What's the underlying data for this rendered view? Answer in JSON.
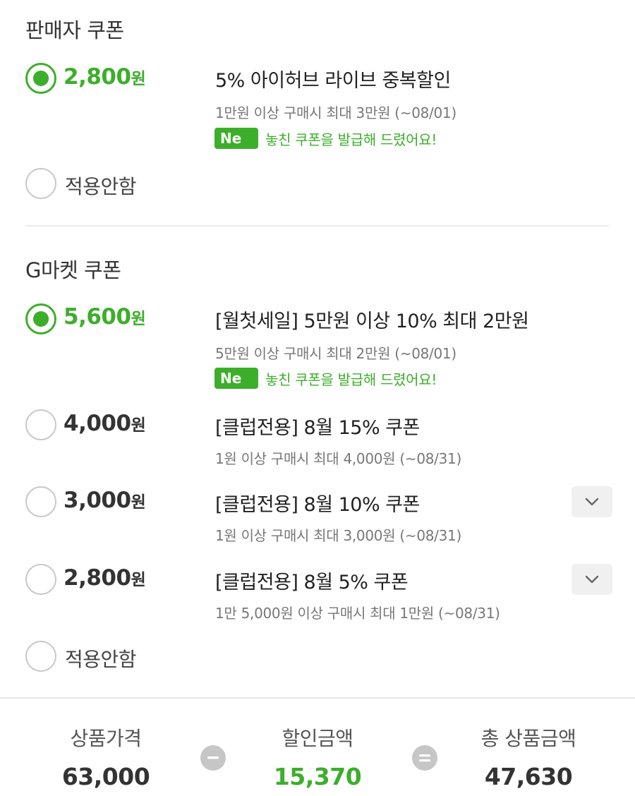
{
  "seller_section": {
    "title": "판매자 쿠폰",
    "options": [
      {
        "amount": "2,800",
        "unit": "원",
        "selected": true,
        "title": "5% 아이허브 라이브 중복할인",
        "condition": "1만원 이상 구매시 최대 3만원 (~08/01)",
        "badge": "Ne",
        "badge_text": "놓친 쿠폰을 발급해 드렸어요!"
      }
    ],
    "none_label": "적용안함"
  },
  "gmarket_section": {
    "title": "G마켓 쿠폰",
    "options": [
      {
        "amount": "5,600",
        "unit": "원",
        "selected": true,
        "title": "[월첫세일] 5만원 이상 10% 최대 2만원",
        "condition": "5만원 이상 구매시 최대 2만원 (~08/01)",
        "badge": "Ne",
        "badge_text": "놓친 쿠폰을 발급해 드렸어요!"
      },
      {
        "amount": "4,000",
        "unit": "원",
        "selected": false,
        "title": "[클럽전용] 8월 15% 쿠폰",
        "condition": "1원 이상 구매시 최대 4,000원 (~08/31)"
      },
      {
        "amount": "3,000",
        "unit": "원",
        "selected": false,
        "title": "[클럽전용] 8월 10% 쿠폰",
        "condition": "1원 이상 구매시 최대 3,000원 (~08/31)",
        "expand_icon": "chevron-down-icon"
      },
      {
        "amount": "2,800",
        "unit": "원",
        "selected": false,
        "title": "[클럽전용] 8월 5% 쿠폰",
        "condition": "1만 5,000원 이상 구매시 최대 1만원 (~08/31)",
        "expand_icon": "chevron-down-icon"
      }
    ],
    "none_label": "적용안함"
  },
  "summary": {
    "product_price_label": "상품가격",
    "product_price": "63,000",
    "discount_label": "할인금액",
    "discount": "15,370",
    "total_label": "총 상품금액",
    "total": "47,630",
    "minus_icon": "minus-icon",
    "equals_icon": "equals-icon"
  },
  "colors": {
    "accent": "#3dae2b",
    "text": "#222222",
    "muted": "#777777",
    "operator": "#c6c6c6"
  }
}
